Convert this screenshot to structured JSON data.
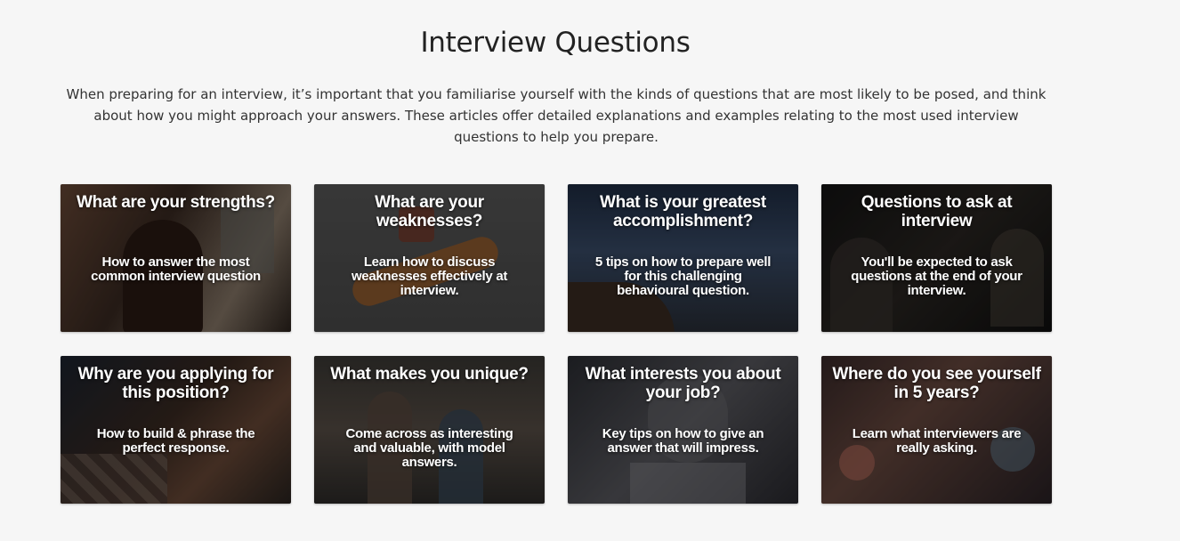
{
  "section": {
    "title": "Interview Questions",
    "intro": "When preparing for an interview, it’s important that you familiarise yourself with the kinds of questions that are most likely to be posed, and think about how you might approach your answers. These articles offer detailed explanations and examples relating to the most used interview questions to help you prepare."
  },
  "cards": [
    {
      "title": "What are your strengths?",
      "subtitle": "How to answer the most common interview question"
    },
    {
      "title": "What are your weaknesses?",
      "subtitle": "Learn how to discuss weaknesses effectively at interview."
    },
    {
      "title": "What is your greatest accomplishment?",
      "subtitle": "5 tips on how to prepare well for this challenging behavioural question."
    },
    {
      "title": "Questions to ask at interview",
      "subtitle": "You'll be expected to ask questions at the end of your interview."
    },
    {
      "title": "Why are you applying for this position?",
      "subtitle": "How to build & phrase the perfect response."
    },
    {
      "title": "What makes you unique?",
      "subtitle": "Come across as interesting and valuable, with model answers."
    },
    {
      "title": "What interests you about your job?",
      "subtitle": "Key tips on how to give an answer that will impress."
    },
    {
      "title": "Where do you see yourself in 5 years?",
      "subtitle": "Learn what interviewers are really asking."
    }
  ]
}
